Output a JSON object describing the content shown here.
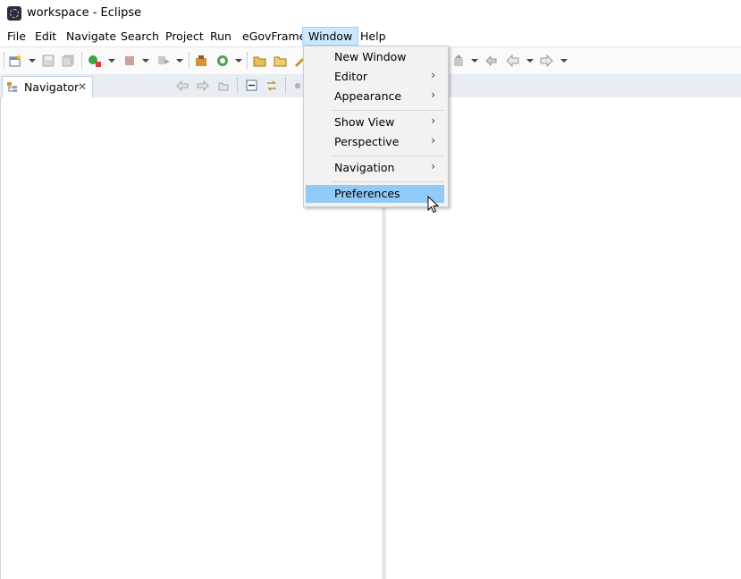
{
  "window": {
    "title": "workspace - Eclipse",
    "icon": "eclipse-logo-icon"
  },
  "menubar": {
    "items": [
      "File",
      "Edit",
      "Navigate",
      "Search",
      "Project",
      "Run",
      "eGovFrame",
      "Window",
      "Help"
    ],
    "active": "Window"
  },
  "window_menu": {
    "items": [
      {
        "label": "New Window",
        "submenu": false
      },
      {
        "label": "Editor",
        "submenu": true
      },
      {
        "label": "Appearance",
        "submenu": true
      },
      {
        "label": "Show View",
        "submenu": true
      },
      {
        "label": "Perspective",
        "submenu": true
      },
      {
        "label": "Navigation",
        "submenu": true
      },
      {
        "label": "Preferences",
        "submenu": false,
        "highlighted": true
      }
    ],
    "submenu_glyph": "›"
  },
  "navigator": {
    "tab_label": "Navigator",
    "close_glyph": "✕"
  },
  "colors": {
    "menu_highlight": "#91c9f7",
    "active_menu_bg": "#cce8ff",
    "panel_header": "#e8edf3"
  }
}
